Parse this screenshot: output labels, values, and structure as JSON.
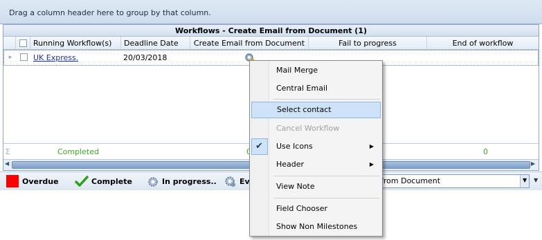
{
  "group_panel": {
    "hint": "Drag a column header here to group by that column."
  },
  "grid": {
    "title": "Workflows - Create Email from Document (1)",
    "columns": [
      "Running Workflow(s)",
      "Deadline Date",
      "Create Email from Document",
      "Fail to progress",
      "End of workflow"
    ],
    "rows": [
      {
        "workflow": "UK Express.",
        "deadline": "20/03/2018"
      }
    ],
    "footer": {
      "completed": "Completed",
      "create_count": "0",
      "end_count": "0"
    }
  },
  "legend": {
    "overdue": "Overdue",
    "complete": "Complete",
    "in_progress": "In progress..",
    "events_partial": "Ev",
    "combo_value": "from Document",
    "overdue_color": "#ff0000",
    "complete_color": "#2aa01a"
  },
  "context_menu": {
    "items": [
      {
        "label": "Mail Merge"
      },
      {
        "label": "Central Email"
      },
      {
        "label": "Select contact",
        "state": "highlighted"
      },
      {
        "label": "Cancel Workflow",
        "state": "disabled"
      },
      {
        "label": "Use Icons",
        "checked": true,
        "submenu": true
      },
      {
        "label": "Header",
        "submenu": true
      },
      {
        "label": "View Note"
      },
      {
        "label": "Field Chooser"
      },
      {
        "label": "Show Non Milestones"
      }
    ]
  }
}
